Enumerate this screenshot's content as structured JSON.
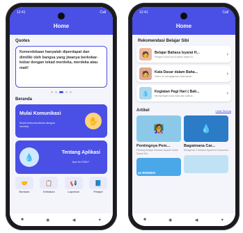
{
  "left_phone": {
    "status": {
      "time": "12:41",
      "signal": "Call"
    },
    "header_title": "Home",
    "quotes_title": "Quotes",
    "quote_text": "Kemerdekaan hanyalah diperdapat dan dimiliki oleh bangsa yang jiwanya berkobar-kobar dengan tekad merdeka, merdeka atau mati!",
    "beranda_title": "Beranda",
    "features": [
      {
        "title": "Mulai Komunikasi",
        "subtitle": "Mulai berkomunikasi dengan mereka"
      },
      {
        "title": "Tentang Aplikasi",
        "subtitle": "Apa itu DSib?"
      }
    ],
    "menu": [
      {
        "label": "Bantuan"
      },
      {
        "label": "Kebiakan"
      },
      {
        "label": "Laporkan"
      },
      {
        "label": "Pelajari"
      }
    ]
  },
  "right_phone": {
    "status": {
      "time": "12:41",
      "signal": "Call"
    },
    "header_title": "Home",
    "recommend_title": "Rekomendasi Belajar Sibi",
    "recommendations": [
      {
        "title": "Belajar Bahasa Isyarat H...",
        "subtitle": "Pelajari huruf-huruf dasar dalam B..."
      },
      {
        "title": "Kata Dasar dalam Baha...",
        "subtitle": "Video ini mengajarkan kata dasar..."
      },
      {
        "title": "Kegiatan Pagi Hari ( Bah...",
        "subtitle": "Mempelajari kosa kata dan kalima..."
      }
    ],
    "article_title": "Artikel",
    "see_all": "Lihat Semua",
    "articles": [
      {
        "title": "Pentingnya Pem...",
        "subtitle": "Penting Belajar Bahasa Isyarat Untuk Sosial Din..."
      },
      {
        "title": "Bagaimana Car...",
        "subtitle": "Mengenal 2 bahasa Isyarat di Indonesia"
      }
    ],
    "article_banner": "an BISINDO"
  },
  "colors": {
    "primary": "#4a4fe6",
    "background": "#f4f5fb"
  },
  "nav_icons": [
    "square-icon",
    "circle-home-icon",
    "back-triangle-icon",
    "accessibility-icon"
  ]
}
